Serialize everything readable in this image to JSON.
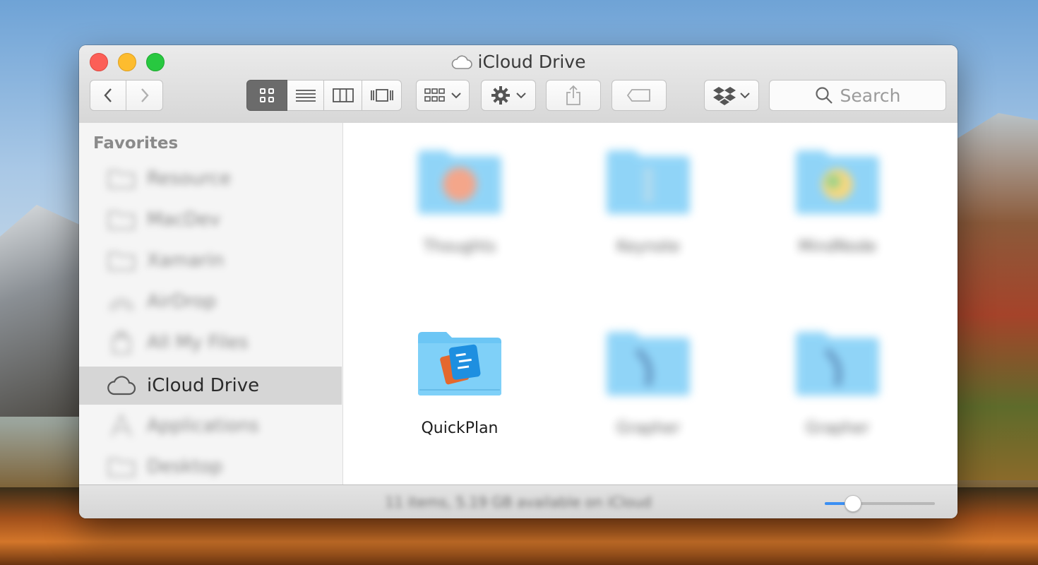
{
  "window": {
    "title": "iCloud Drive"
  },
  "toolbar": {
    "view_modes": [
      "icon",
      "list",
      "column",
      "cover-flow"
    ],
    "active_view": "icon",
    "search_placeholder": "Search"
  },
  "sidebar": {
    "section_title": "Favorites",
    "items": [
      {
        "label": "Resource",
        "icon": "folder-icon",
        "blurred": true
      },
      {
        "label": "MacDev",
        "icon": "folder-icon",
        "blurred": true
      },
      {
        "label": "Xamarin",
        "icon": "folder-icon",
        "blurred": true
      },
      {
        "label": "AirDrop",
        "icon": "airdrop-icon",
        "blurred": true
      },
      {
        "label": "All My Files",
        "icon": "files-icon",
        "blurred": true
      },
      {
        "label": "iCloud Drive",
        "icon": "cloud-icon",
        "blurred": false,
        "selected": true
      },
      {
        "label": "Applications",
        "icon": "applications-icon",
        "blurred": true
      },
      {
        "label": "Desktop",
        "icon": "folder-icon",
        "blurred": true
      }
    ]
  },
  "files": [
    {
      "name": "Thoughts",
      "blurred": true,
      "badge": "#f0815a"
    },
    {
      "name": "Keynote",
      "blurred": true,
      "badge": "#8fcbe9"
    },
    {
      "name": "MindNode",
      "blurred": true,
      "badge": "#f2c84b"
    },
    {
      "name": "QuickPlan",
      "blurred": false,
      "badge": "#1e8fe0"
    },
    {
      "name": "Grapher",
      "blurred": true,
      "badge": "#2a73b0"
    },
    {
      "name": "Grapher",
      "blurred": true,
      "badge": "#2a73b0"
    }
  ],
  "status": {
    "text": "11 items, 5.19 GB available on iCloud",
    "icon_size_fraction": 0.25
  },
  "colors": {
    "accent": "#3b8ff3",
    "folder": "#62c3f5",
    "selection": "#d6d6d6"
  }
}
